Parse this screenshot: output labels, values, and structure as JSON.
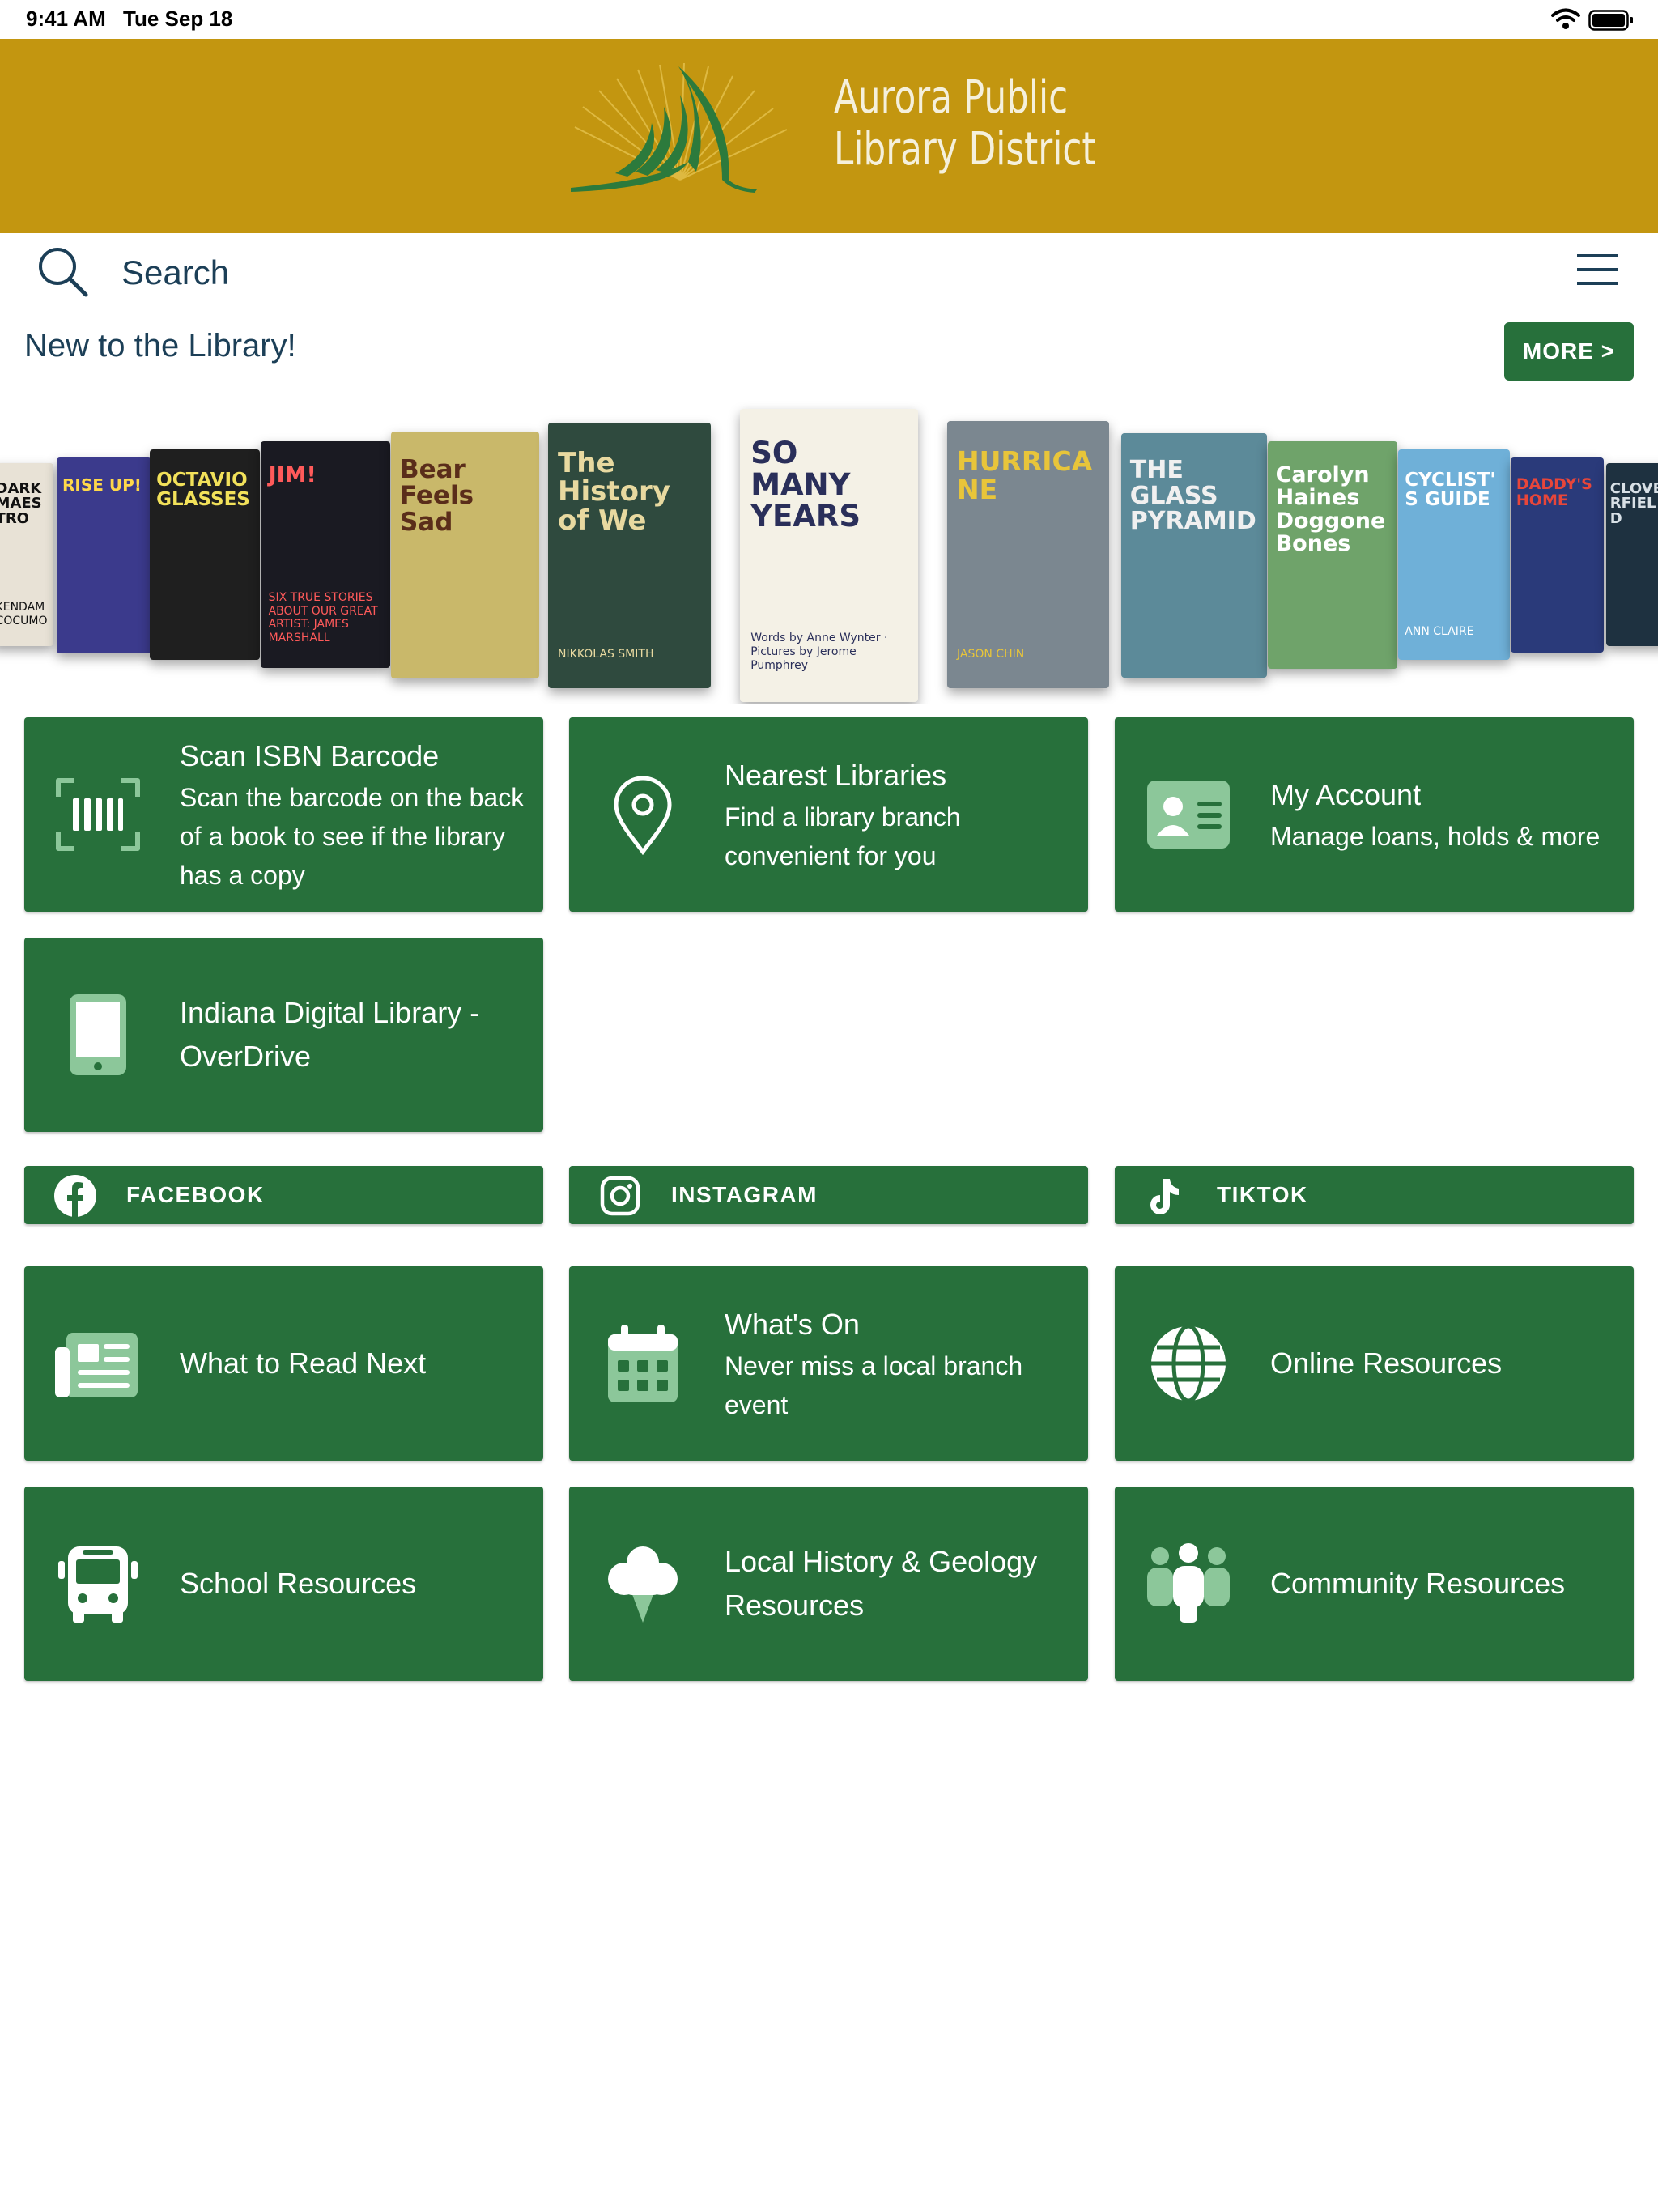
{
  "theme": {
    "header_gold": "#c39610",
    "tile_green": "#27703b",
    "text_navy": "#1c3f57",
    "logo_green": "#2c7a3c"
  },
  "status_bar": {
    "time": "9:41 AM",
    "date": "Tue Sep 18"
  },
  "header": {
    "logo_line1": "Aurora Public",
    "logo_line2": "Library District"
  },
  "search": {
    "placeholder": "Search"
  },
  "new_section": {
    "title": "New to the Library!",
    "more_label": "MORE >"
  },
  "books": [
    {
      "title": "DARK MAESTRO",
      "author": "KENDAM COCUMO",
      "bg": "#e8e2d6",
      "fg": "#111111"
    },
    {
      "title": "RISE UP!",
      "author": "",
      "bg": "#3b3a8c",
      "fg": "#ffd84a"
    },
    {
      "title": "OCTAVIO GLASSES",
      "author": "",
      "bg": "#1f1f1f",
      "fg": "#f2e15a"
    },
    {
      "title": "JIM!",
      "author": "SIX TRUE STORIES ABOUT OUR GREAT ARTIST: JAMES MARSHALL",
      "bg": "#1a1a22",
      "fg": "#ff5a5a"
    },
    {
      "title": "Bear Feels Sad",
      "author": "",
      "bg": "#c9b86a",
      "fg": "#5a2d1a"
    },
    {
      "title": "The History of We",
      "author": "NIKKOLAS SMITH",
      "bg": "#2f4a3e",
      "fg": "#e8d9a0"
    },
    {
      "title": "SO MANY YEARS",
      "author": "Words by Anne Wynter · Pictures by Jerome Pumphrey",
      "bg": "#f4f1e6",
      "fg": "#2a2f5a"
    },
    {
      "title": "HURRICANE",
      "author": "JASON CHIN",
      "bg": "#7b8790",
      "fg": "#e8c53a"
    },
    {
      "title": "THE GLASS PYRAMID",
      "author": "",
      "bg": "#5c8a99",
      "fg": "#f0f0f0"
    },
    {
      "title": "Carolyn Haines Doggone Bones",
      "author": "",
      "bg": "#6fa36a",
      "fg": "#ffffff"
    },
    {
      "title": "CYCLIST'S GUIDE",
      "author": "ANN CLAIRE",
      "bg": "#6fb0d8",
      "fg": "#ffffff"
    },
    {
      "title": "DADDY'S HOME",
      "author": "",
      "bg": "#2a3a7a",
      "fg": "#e8463a"
    },
    {
      "title": "CLOVERFIELD",
      "author": "",
      "bg": "#1e3140",
      "fg": "#d8e0e6"
    }
  ],
  "tiles": [
    {
      "title": "Scan ISBN Barcode",
      "subtitle": "Scan the barcode on the back of a book to see if the library has a copy",
      "icon": "barcode-scan-icon"
    },
    {
      "title": "Nearest Libraries",
      "subtitle": "Find a library branch convenient for you",
      "icon": "location-pin-icon"
    },
    {
      "title": "My Account",
      "subtitle": "Manage loans, holds & more",
      "icon": "id-card-icon"
    },
    {
      "title": "Indiana Digital Library - OverDrive",
      "subtitle": "",
      "icon": "tablet-icon"
    }
  ],
  "social": [
    {
      "label": "FACEBOOK",
      "icon": "facebook-icon"
    },
    {
      "label": "INSTAGRAM",
      "icon": "instagram-icon"
    },
    {
      "label": "TIKTOK",
      "icon": "tiktok-icon"
    }
  ],
  "tiles2": [
    {
      "title": "What to Read Next",
      "subtitle": "",
      "icon": "newspaper-icon"
    },
    {
      "title": "What's On",
      "subtitle": "Never miss a local branch event",
      "icon": "calendar-icon"
    },
    {
      "title": "Online Resources",
      "subtitle": "",
      "icon": "globe-icon"
    },
    {
      "title": "School Resources",
      "subtitle": "",
      "icon": "school-bus-icon"
    },
    {
      "title": "Local History & Geology Resources",
      "subtitle": "",
      "icon": "tree-icon"
    },
    {
      "title": "Community Resources",
      "subtitle": "",
      "icon": "people-group-icon"
    }
  ]
}
